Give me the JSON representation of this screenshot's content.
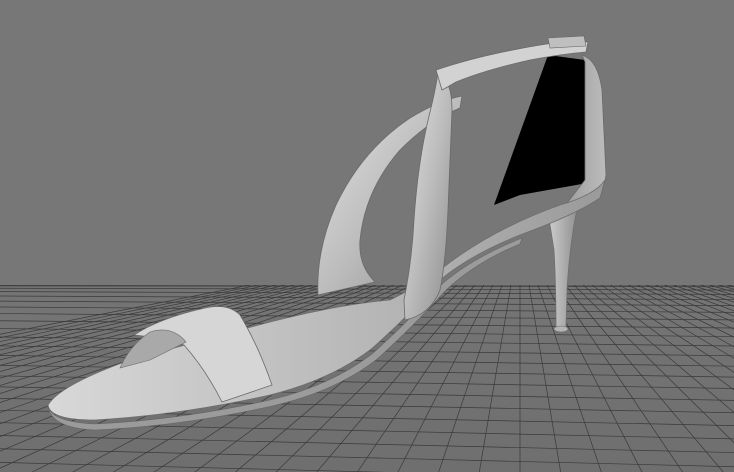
{
  "viewport": {
    "background_color": "#777777",
    "grid_color": "#3a3a3a",
    "model_color": "#cfcfcf",
    "model_shadow_color": "#8c8c8c",
    "interior_color": "#000000"
  },
  "scene": {
    "object": "high-heel-sandal-model",
    "view": "perspective",
    "grid": true
  }
}
